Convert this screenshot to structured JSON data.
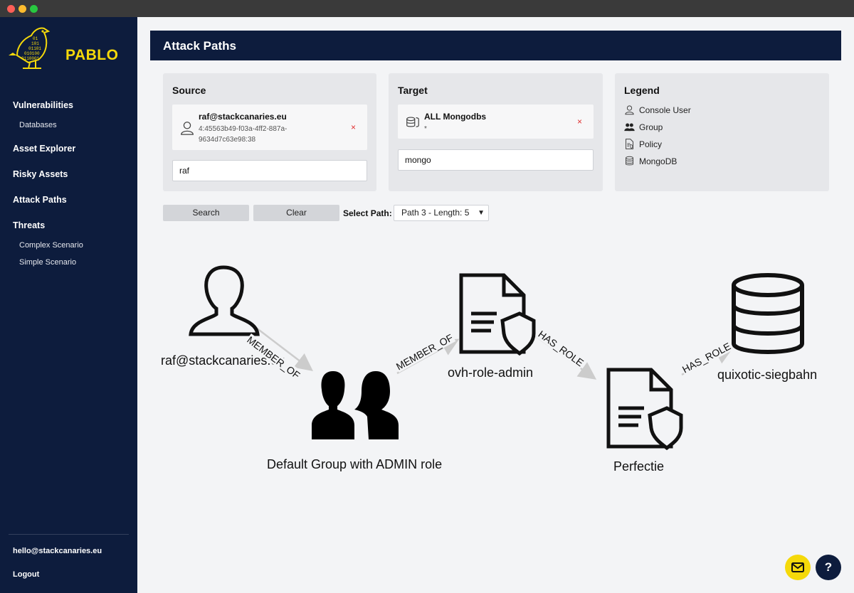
{
  "app": {
    "name": "PABLO"
  },
  "sidebar": {
    "items": [
      {
        "label": "Vulnerabilities"
      },
      {
        "label": "Databases"
      },
      {
        "label": "Asset Explorer"
      },
      {
        "label": "Risky Assets"
      },
      {
        "label": "Attack Paths"
      },
      {
        "label": "Threats"
      },
      {
        "label": "Complex Scenario"
      },
      {
        "label": "Simple Scenario"
      }
    ],
    "user_email": "hello@stackcanaries.eu",
    "logout_label": "Logout"
  },
  "header": {
    "title": "Attack Paths"
  },
  "source": {
    "title": "Source",
    "selected_name": "raf@stackcanaries.eu",
    "selected_id": "4:45563b49-f03a-4ff2-887a-9634d7c63e98:38",
    "remove": "×",
    "input_value": "raf"
  },
  "target": {
    "title": "Target",
    "selected_name": "ALL Mongodbs",
    "selected_sub": "*",
    "remove": "×",
    "input_value": "mongo"
  },
  "legend": {
    "title": "Legend",
    "items": [
      {
        "label": "Console User",
        "icon": "user-icon"
      },
      {
        "label": "Group",
        "icon": "group-icon"
      },
      {
        "label": "Policy",
        "icon": "policy-icon"
      },
      {
        "label": "MongoDB",
        "icon": "database-icon"
      }
    ]
  },
  "controls": {
    "search_label": "Search",
    "clear_label": "Clear",
    "select_label": "Select Path:",
    "selected_path": "Path 3 - Length: 5"
  },
  "graph": {
    "nodes": [
      {
        "label": "raf@stackcanaries.eu",
        "type": "user-icon"
      },
      {
        "label": "Default Group with ADMIN role",
        "type": "group-icon"
      },
      {
        "label": "ovh-role-admin",
        "type": "policy-icon"
      },
      {
        "label": "Perfectie",
        "type": "policy-icon"
      },
      {
        "label": "quixotic-siegbahn",
        "type": "database-icon"
      }
    ],
    "edges": [
      {
        "label": "MEMBER_OF"
      },
      {
        "label": "MEMBER_OF"
      },
      {
        "label": "HAS_ROLE"
      },
      {
        "label": "HAS_ROLE"
      }
    ]
  },
  "fabs": {
    "help_label": "?"
  },
  "colors": {
    "navy": "#0d1c3d",
    "accent": "#f5d90a",
    "remove": "#e03030"
  }
}
